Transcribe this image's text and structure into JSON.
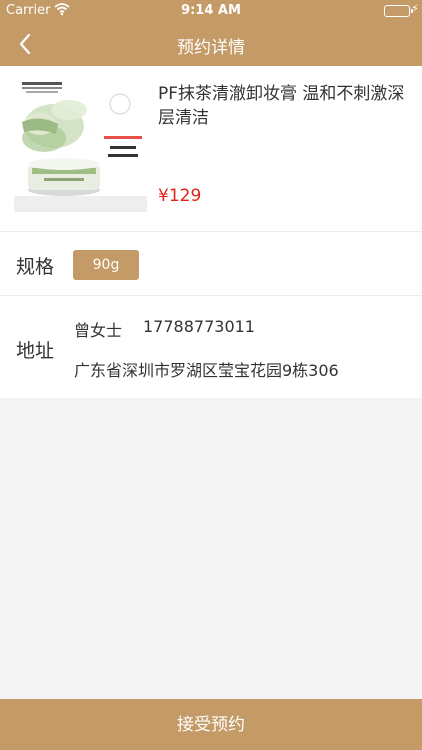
{
  "status_bar": {
    "carrier": "Carrier",
    "time": "9:14 AM",
    "battery_level": 1.0
  },
  "nav": {
    "title": "预约详情",
    "back_icon": "chevron-left-icon"
  },
  "product": {
    "name": "PF抹茶清澈卸妆膏 温和不刺激深层清洁",
    "price": "¥129",
    "image_icon": "product-photo"
  },
  "spec": {
    "label": "规格",
    "selected": "90g"
  },
  "address": {
    "label": "地址",
    "name": "曾女士",
    "phone": "17788773011",
    "full": "广东省深圳市罗湖区莹宝花园9栋306"
  },
  "footer": {
    "accept_label": "接受预约"
  },
  "colors": {
    "brand": "#c49a66",
    "price": "#e2231a",
    "background": "#f4f4f4"
  }
}
